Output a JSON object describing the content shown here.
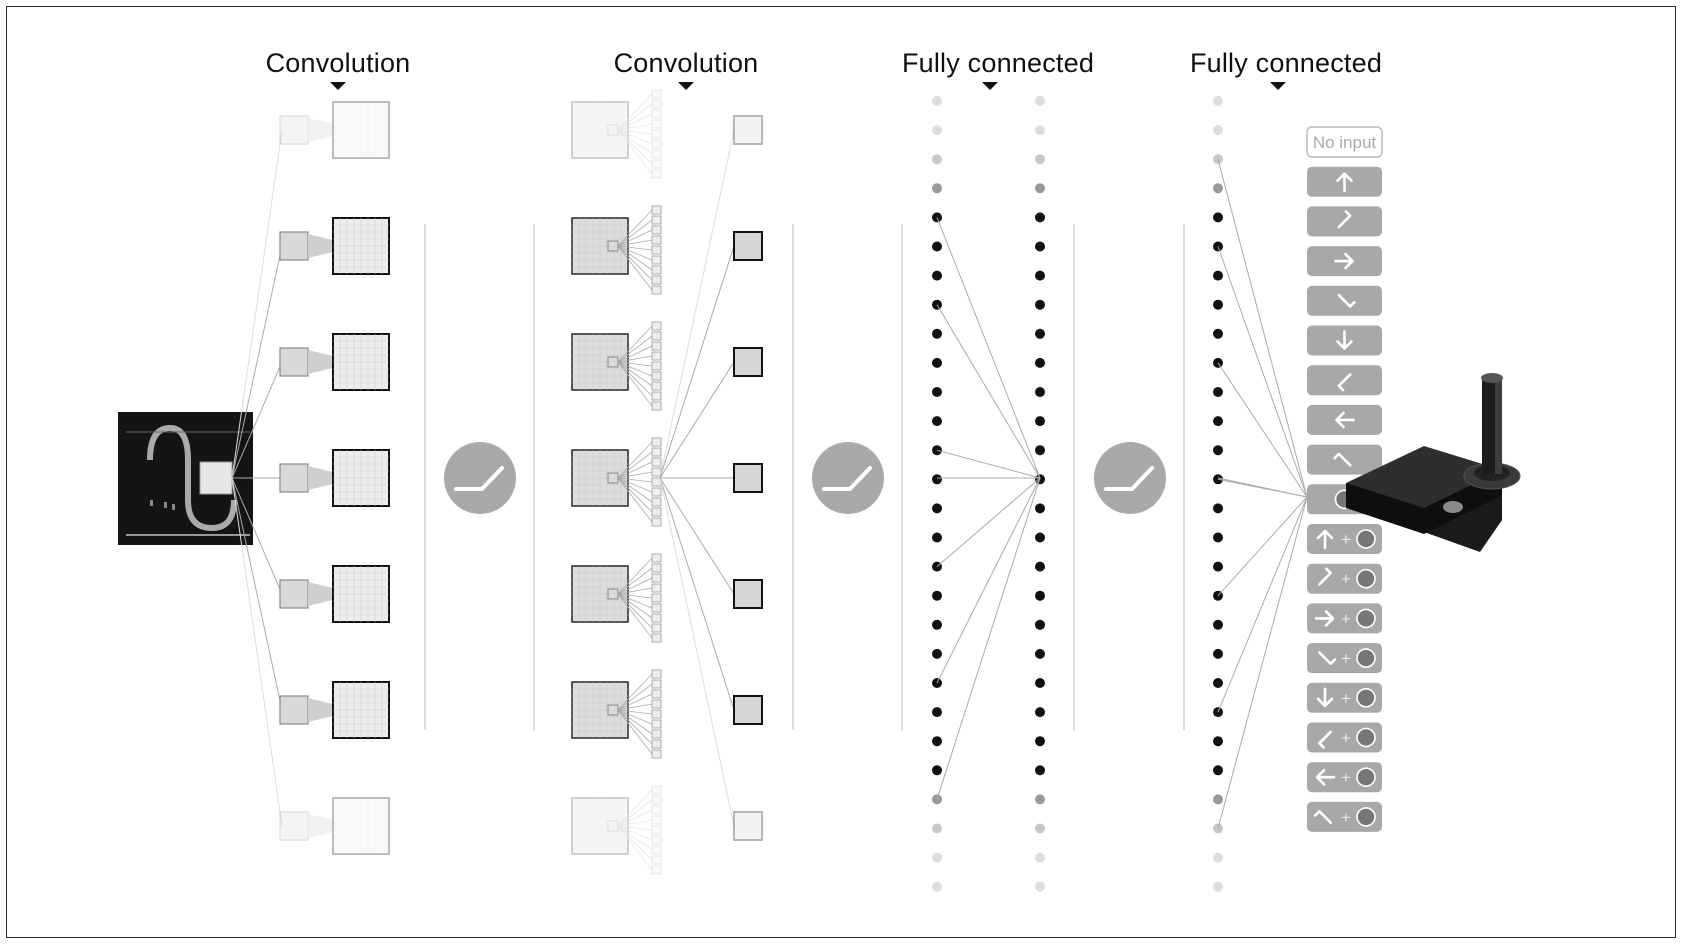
{
  "layers": [
    {
      "title": "Convolution"
    },
    {
      "title": "Convolution"
    },
    {
      "title": "Fully connected"
    },
    {
      "title": "Fully connected"
    }
  ],
  "input": {
    "icon": "game-screen"
  },
  "activations": {
    "count": 3,
    "icon": "relu-icon"
  },
  "outputs": [
    {
      "label": "No input",
      "direction": "none",
      "fire": false
    },
    {
      "label": "",
      "direction": "up",
      "fire": false
    },
    {
      "label": "",
      "direction": "up-right",
      "fire": false
    },
    {
      "label": "",
      "direction": "right",
      "fire": false
    },
    {
      "label": "",
      "direction": "down-right",
      "fire": false
    },
    {
      "label": "",
      "direction": "down",
      "fire": false
    },
    {
      "label": "",
      "direction": "down-left",
      "fire": false
    },
    {
      "label": "",
      "direction": "left",
      "fire": false
    },
    {
      "label": "",
      "direction": "up-left",
      "fire": false
    },
    {
      "label": "",
      "direction": "none",
      "fire": true
    },
    {
      "label": "+",
      "direction": "up",
      "fire": true
    },
    {
      "label": "+",
      "direction": "up-right",
      "fire": true
    },
    {
      "label": "+",
      "direction": "right",
      "fire": true
    },
    {
      "label": "+",
      "direction": "down-right",
      "fire": true
    },
    {
      "label": "+",
      "direction": "down",
      "fire": true
    },
    {
      "label": "+",
      "direction": "down-left",
      "fire": true
    },
    {
      "label": "+",
      "direction": "left",
      "fire": true
    },
    {
      "label": "+",
      "direction": "up-left",
      "fire": true
    }
  ],
  "controller": {
    "icon": "joystick-icon"
  },
  "colors": {
    "node_dark": "#111111",
    "node_light": "#cccccc",
    "button": "#a8a8a8",
    "relu": "#a9a9a9",
    "screen": "#141414"
  }
}
